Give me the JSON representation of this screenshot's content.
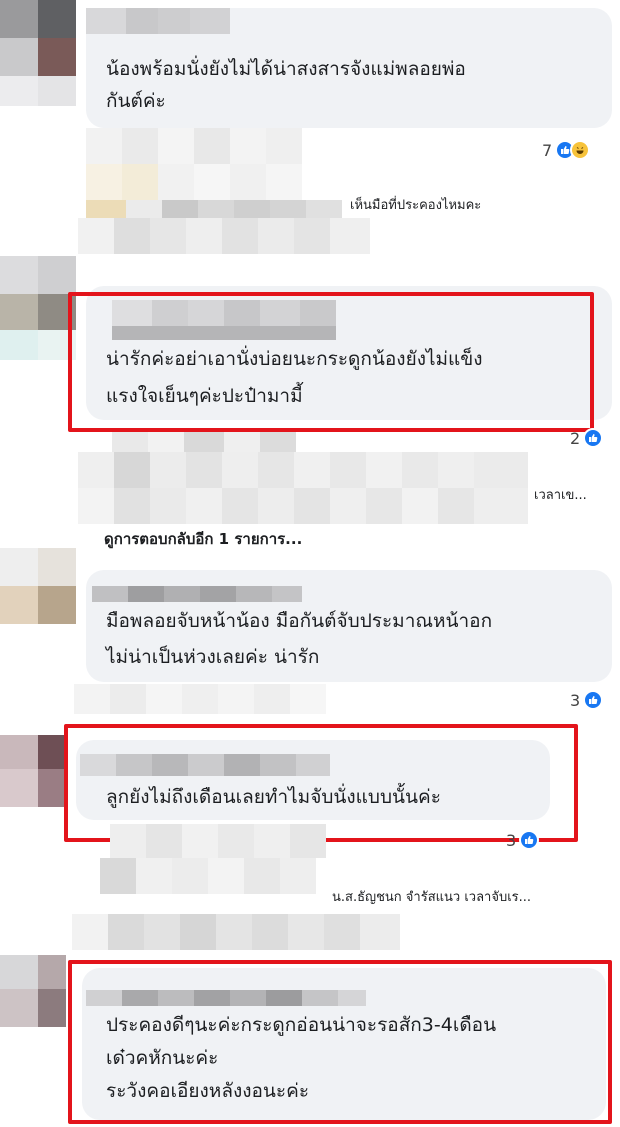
{
  "comments": [
    {
      "text_lines": [
        "น้องพร้อมนั่งยังไม่ได้น่าสงสารจังแม่พลอยพ่อ",
        "กันต์ค่ะ"
      ],
      "reaction_count": "7",
      "reactions": [
        "like-icon",
        "haha-icon"
      ]
    },
    {
      "text_lines": [
        "น่ารักค่ะอย่าเอานั่งบ่อยนะกระดูกน้องยังไม่แข็ง",
        "แรงใจเย็นๆค่ะปะป๋ามามี้"
      ],
      "reaction_count": "2",
      "reactions": [
        "like-icon"
      ],
      "highlighted": true
    },
    {
      "text_lines": [
        "มือพลอยจับหน้าน้อง มือกันต์จับประมาณหน้าอก",
        "ไม่น่าเป็นห่วงเลยค่ะ น่ารัก"
      ],
      "reaction_count": "3",
      "reactions": [
        "like-icon"
      ]
    },
    {
      "text_lines": [
        "ลูกยังไม่ถึงเดือนเลยทำไมจับนั่งแบบนั้นค่ะ"
      ],
      "reaction_count": "3",
      "reactions": [
        "like-icon"
      ],
      "highlighted": true
    },
    {
      "text_lines": [
        "ประคองดีๆนะค่ะกระดูกอ่อนน่าจะรอสัก3-4เดือน",
        "เด๋วคหักนะค่ะ",
        "ระวังคอเอียงหลังงอนะค่ะ"
      ],
      "highlighted": true
    }
  ],
  "replies": {
    "reply1_preview": "เห็นมือที่ประคองไหมคะ",
    "reply2_preview": "เวลาเข...",
    "view_more": "ดูการตอบกลับอีก 1 รายการ...",
    "reply3_preview": "น.ส.ธัญชนก จำรัสแนว เวลาจับเร..."
  },
  "colors": {
    "bubble": "#f0f2f5",
    "highlight_box": "#e3141b",
    "like_blue": "#1877f2",
    "haha_yellow": "#f7c33b"
  }
}
